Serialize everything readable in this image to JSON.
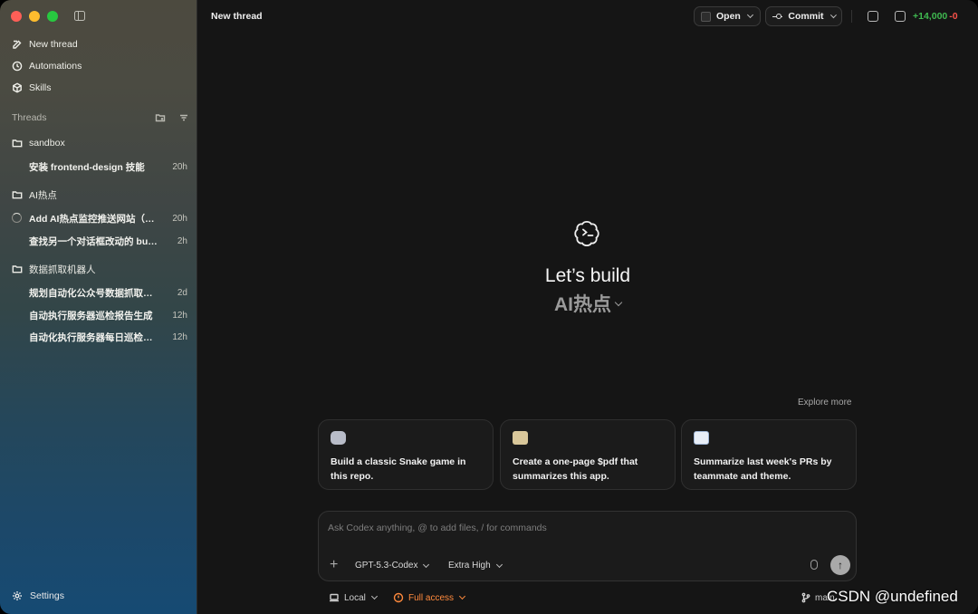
{
  "sidebar": {
    "nav": [
      {
        "label": "New thread",
        "icon": "edit-icon"
      },
      {
        "label": "Automations",
        "icon": "clock-icon"
      },
      {
        "label": "Skills",
        "icon": "cube-icon"
      }
    ],
    "section_title": "Threads",
    "folders": [
      {
        "name": "sandbox",
        "threads": [
          {
            "title": "安装 frontend-design 技能",
            "time": "20h"
          }
        ]
      },
      {
        "name": "AI热点",
        "threads": [
          {
            "title": "Add AI热点监控推送网站（飞书）",
            "time": "20h",
            "loading": true
          },
          {
            "title": "查找另一个对话框改动的 bug…",
            "time": "2h"
          }
        ]
      },
      {
        "name": "数据抓取机器人",
        "threads": [
          {
            "title": "规划自动化公众号数据抓取方案",
            "time": "2d"
          },
          {
            "title": "自动执行服务器巡检报告生成",
            "time": "12h"
          },
          {
            "title": "自动化执行服务器每日巡检任务",
            "time": "12h"
          }
        ]
      }
    ],
    "settings_label": "Settings"
  },
  "header": {
    "title": "New thread",
    "open_label": "Open",
    "commit_label": "Commit",
    "diff_plus": "+14,000",
    "diff_minus": "-0"
  },
  "hero": {
    "title": "Let’s build",
    "project": "AI热点"
  },
  "explore_label": "Explore more",
  "suggestions": [
    {
      "text": "Build a classic Snake game in this repo.",
      "icon": "gamepad-icon"
    },
    {
      "text": "Create a one-page $pdf that summarizes this app.",
      "icon": "scroll-icon"
    },
    {
      "text": "Summarize last week's PRs by teammate and theme.",
      "icon": "document-icon"
    }
  ],
  "composer": {
    "placeholder": "Ask Codex anything, @ to add files, / for commands",
    "model": "GPT-5.3-Codex",
    "effort": "Extra High"
  },
  "footer": {
    "local_label": "Local",
    "access_label": "Full access",
    "branch_label": "main"
  },
  "watermark": "CSDN @undefined",
  "colors": {
    "accent_orange": "#ff8a3d",
    "diff_green": "#3fb950",
    "diff_red": "#f85149"
  }
}
